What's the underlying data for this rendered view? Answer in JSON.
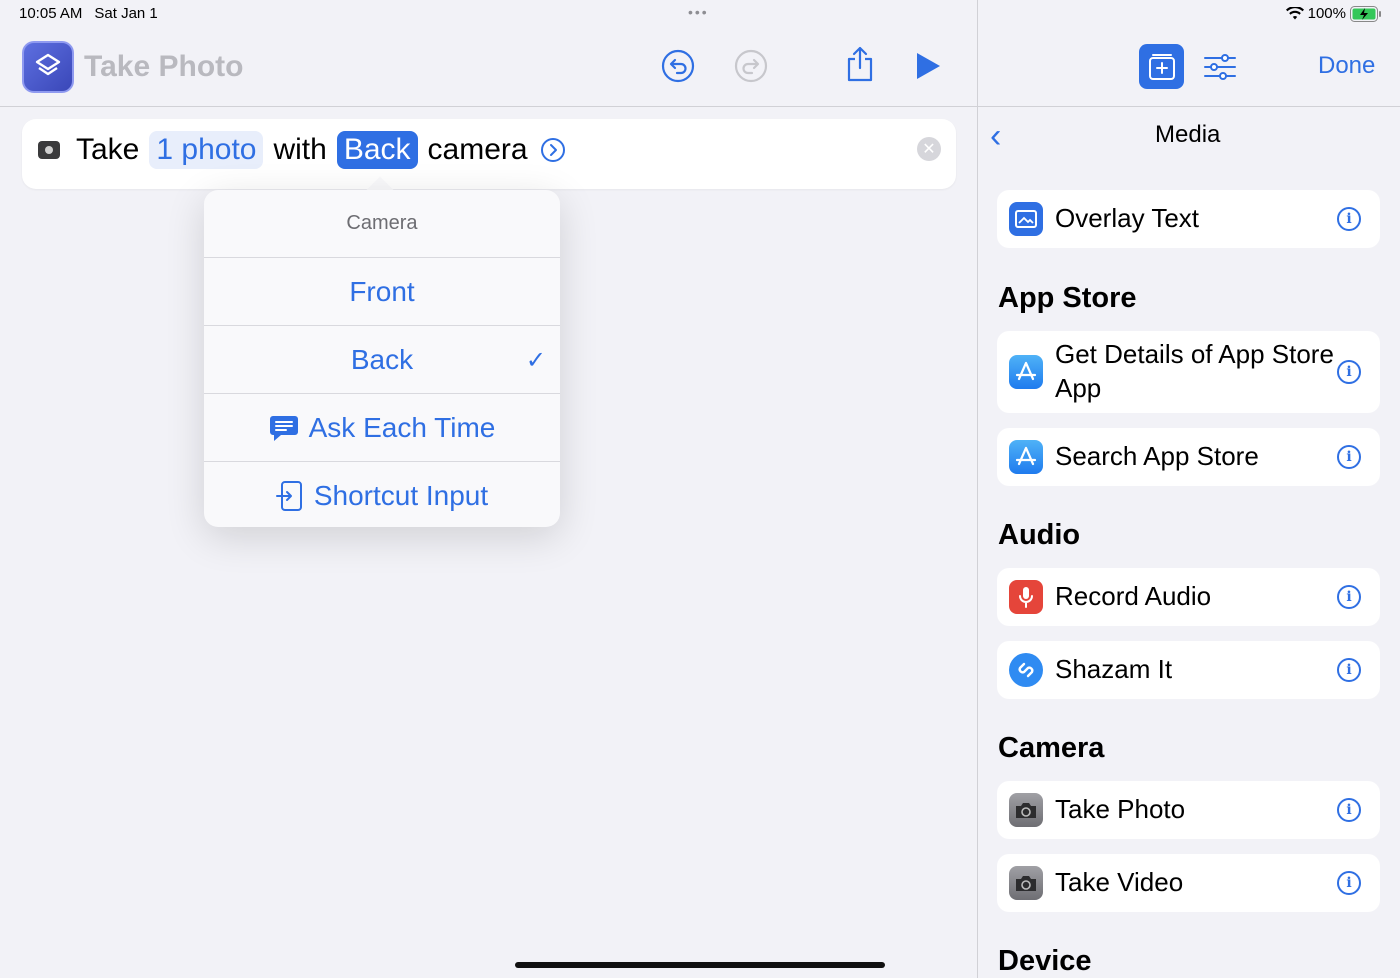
{
  "status": {
    "time": "10:05 AM",
    "date": "Sat Jan 1",
    "battery": "100%"
  },
  "editor": {
    "title": "Take Photo",
    "action": {
      "word_take": "Take",
      "count_token": "1 photo",
      "word_with": "with",
      "camera_token": "Back",
      "word_camera": "camera"
    },
    "popover": {
      "title": "Camera",
      "options": [
        "Front",
        "Back",
        "Ask Each Time",
        "Shortcut Input"
      ],
      "selected": "Back"
    }
  },
  "panel": {
    "done_label": "Done",
    "title": "Media",
    "overlay_label": "Overlay Text",
    "sections": [
      {
        "heading": "App Store",
        "items": [
          "Get Details of App Store App",
          "Search App Store"
        ]
      },
      {
        "heading": "Audio",
        "items": [
          "Record Audio",
          "Shazam It"
        ]
      },
      {
        "heading": "Camera",
        "items": [
          "Take Photo",
          "Take Video"
        ]
      },
      {
        "heading": "Device",
        "items": []
      }
    ]
  },
  "colors": {
    "accent": "#2f6fe3",
    "record_red": "#e5453a",
    "camera_gray": "#4a4a4e"
  }
}
